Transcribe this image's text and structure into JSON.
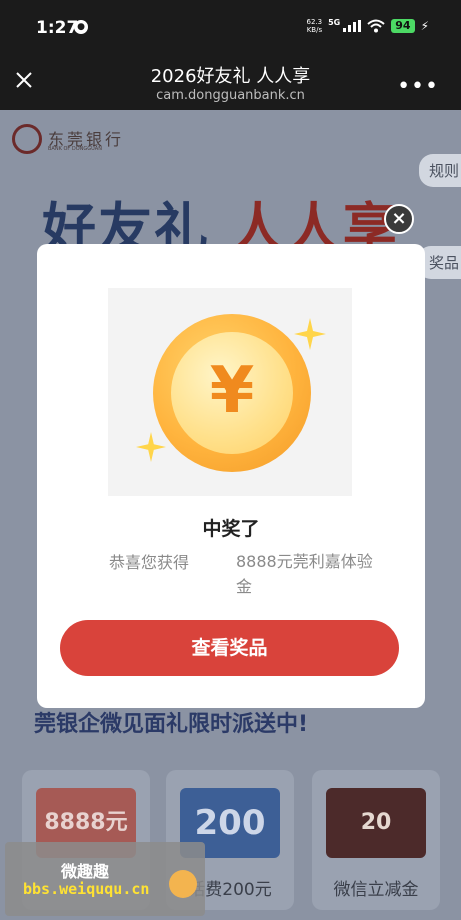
{
  "status_bar": {
    "time": "1:27",
    "net_speed": "62.3",
    "net_unit": "KB/s",
    "network": "5G",
    "battery": "94"
  },
  "title_bar": {
    "title": "2026好友礼 人人享",
    "domain": "cam.dongguanbank.cn"
  },
  "background_page": {
    "bank_name": "东莞银行",
    "bank_name_en": "BANK OF DONGGUAN",
    "rules_tab": "规则",
    "hero_part1": "好友礼",
    "hero_part2": "人人享",
    "prize_tab": "奖品",
    "banner_text": "莞银企微见面礼限时派送中!",
    "cards": [
      {
        "image_text": "8888元",
        "label": ""
      },
      {
        "image_text": "200",
        "label": "话费200元"
      },
      {
        "image_text": "20",
        "label": "微信立减金"
      }
    ]
  },
  "modal": {
    "close_symbol": "×",
    "title": "中奖了",
    "detail_label": "恭喜您获得",
    "detail_value": "8888元莞利嘉体验金",
    "button_label": "查看奖品",
    "coin_symbol": "¥"
  },
  "watermark": {
    "line1": "微趣趣",
    "line2": "bbs.weiququ.cn"
  },
  "colors": {
    "accent_red": "#d9433b",
    "coin_orange": "#f39a26"
  }
}
